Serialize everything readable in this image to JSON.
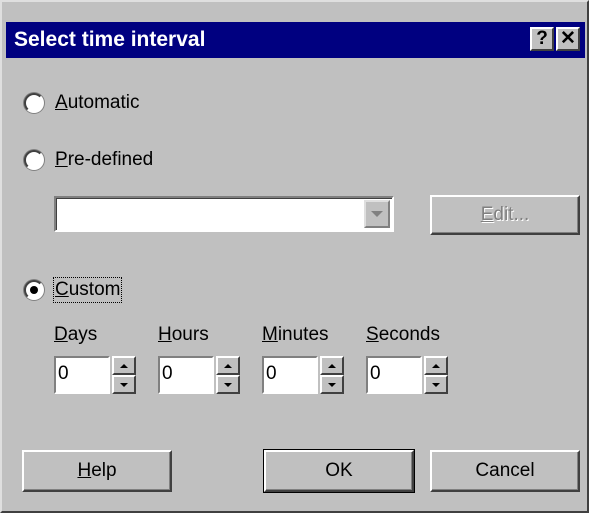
{
  "dialog": {
    "title": "Select time interval",
    "help_glyph": "?",
    "close_glyph": "✕"
  },
  "options": {
    "automatic": {
      "mnemonic": "A",
      "rest": "utomatic",
      "checked": false
    },
    "predefined": {
      "mnemonic": "P",
      "rest": "re-defined",
      "checked": false
    },
    "custom": {
      "mnemonic": "C",
      "rest": "ustom",
      "checked": true
    }
  },
  "predefined_select": {
    "value": ""
  },
  "edit_button": {
    "mnemonic": "E",
    "rest": "dit...",
    "enabled": false
  },
  "custom_fields": [
    {
      "label_mnemonic": "D",
      "label_rest": "ays",
      "value": "0"
    },
    {
      "label_mnemonic": "H",
      "label_rest": "ours",
      "value": "0"
    },
    {
      "label_mnemonic": "M",
      "label_rest": "inutes",
      "value": "0"
    },
    {
      "label_mnemonic": "S",
      "label_rest": "econds",
      "value": "0"
    }
  ],
  "buttons": {
    "help": {
      "mnemonic": "H",
      "rest": "elp"
    },
    "ok": {
      "label": "OK"
    },
    "cancel": {
      "label": "Cancel"
    }
  },
  "icons": {
    "title_help": "question-mark-icon",
    "title_close": "close-icon",
    "spin_up": "arrow-up-icon",
    "spin_down": "arrow-down-icon",
    "combo_arrow": "chevron-down-icon"
  },
  "colors": {
    "titlebar": "#000080",
    "face": "#c0c0c0",
    "disabled_text": "#808080"
  }
}
